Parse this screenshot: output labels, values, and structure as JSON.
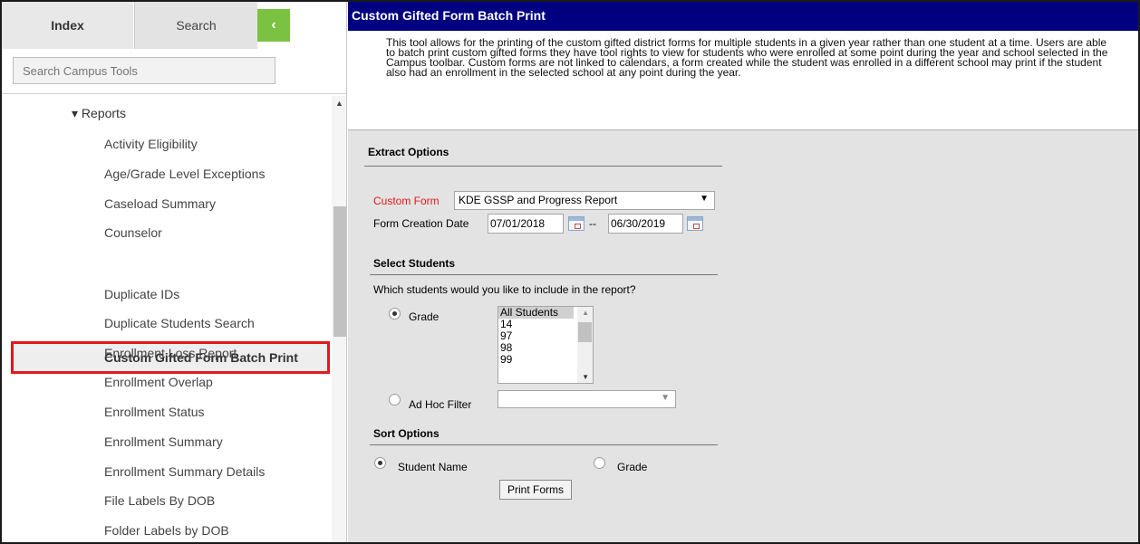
{
  "sidebar": {
    "tabs": {
      "index": "Index",
      "search": "Search",
      "collapse": "‹"
    },
    "search_placeholder": "Search Campus Tools",
    "reports_label": "▾ Reports",
    "items": [
      "Activity Eligibility",
      "Age/Grade Level Exceptions",
      "Caseload Summary",
      "Counselor",
      "Custom Gifted Form Batch Print",
      "Duplicate IDs",
      "Duplicate Students Search",
      "Enrollment Loss Report",
      "Enrollment Overlap",
      "Enrollment Status",
      "Enrollment Summary",
      "Enrollment Summary Details",
      "File Labels By DOB",
      "Folder Labels by DOB"
    ]
  },
  "main": {
    "title": "Custom Gifted Form Batch Print",
    "description": "This tool allows for the printing of the custom gifted district forms for multiple students in a given year rather than one student at a time. Users are able to batch print custom gifted forms they have tool rights to view for students who were enrolled at some point during the year and school selected in the Campus toolbar. Custom forms are not linked to calendars, a form created while the student was enrolled in a different school may print if the student also had an enrollment in the selected school at any point during the year.",
    "extract_options": {
      "heading": "Extract Options",
      "custom_form_label": "Custom Form",
      "custom_form_value": "KDE GSSP and Progress Report",
      "form_creation_label": "Form Creation Date",
      "start_date": "07/01/2018",
      "date_separator": "--",
      "end_date": "06/30/2019"
    },
    "select_students": {
      "heading": "Select Students",
      "question": "Which students would you like to include in the report?",
      "grade_label": "Grade",
      "grade_options": [
        "All Students",
        "14",
        "97",
        "98",
        "99"
      ],
      "adhoc_label": "Ad Hoc Filter",
      "adhoc_value": ""
    },
    "sort_options": {
      "heading": "Sort Options",
      "student_name_label": "Student Name",
      "grade_label": "Grade"
    },
    "print_button": "Print Forms"
  },
  "colors": {
    "title_bar": "#000080",
    "collapse_button": "#7cc242",
    "highlight_border": "#e0191d",
    "required_label": "#e0191d"
  }
}
